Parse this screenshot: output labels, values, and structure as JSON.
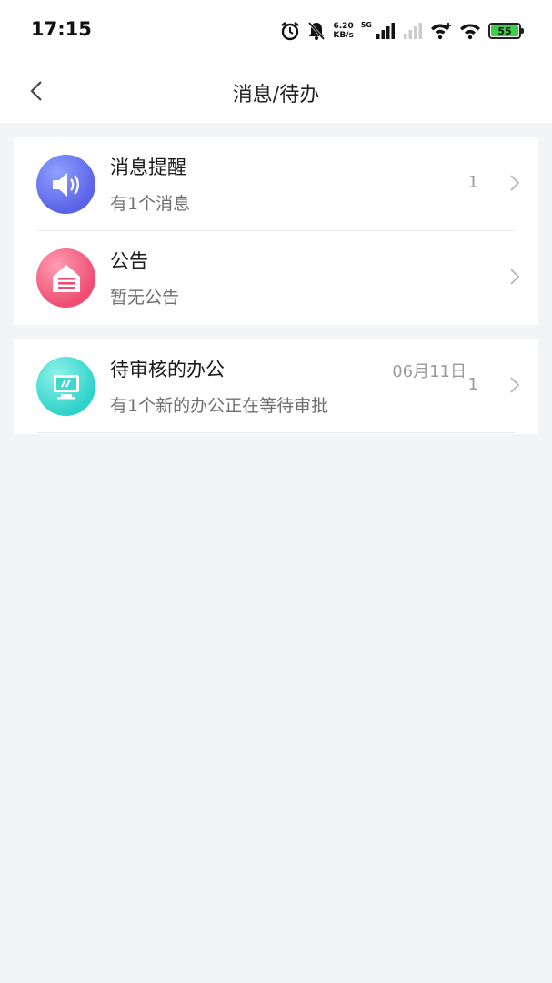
{
  "status_bar": {
    "time": "17:15",
    "speed_value": "6.20",
    "speed_unit": "KB/s",
    "network": "5G",
    "battery": "55"
  },
  "nav": {
    "title": "消息/待办"
  },
  "cards": [
    {
      "items": [
        {
          "title": "消息提醒",
          "subtitle": "有1个消息",
          "count": "1",
          "icon": "speaker-icon",
          "color": "#6b74f0"
        },
        {
          "title": "公告",
          "subtitle": "暂无公告",
          "count": "",
          "icon": "announcement-icon",
          "color": "#f2607f"
        }
      ]
    },
    {
      "items": [
        {
          "title": "待审核的办公",
          "subtitle": "有1个新的办公正在等待审批",
          "date": "06月11日",
          "count": "1",
          "icon": "computer-icon",
          "color": "#3fd9cf"
        }
      ]
    }
  ]
}
